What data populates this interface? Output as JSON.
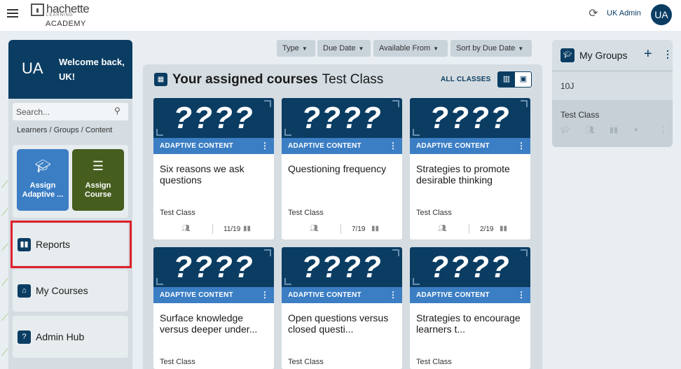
{
  "topbar": {
    "logo_brand": "hachette",
    "logo_sub": "LEARNING",
    "logo_academy": "ACADEMY",
    "user_name": "UK Admin",
    "user_initials": "UA"
  },
  "sidebar": {
    "welcome_initials": "UA",
    "welcome_line1": "Welcome back,",
    "welcome_line2": "UK!",
    "search_placeholder": "Search...",
    "search_hint": "Learners / Groups / Content",
    "tiles": [
      {
        "label": "Assign Adaptive ...",
        "icon": "graduation-cap-icon",
        "color": "#3b7ec4"
      },
      {
        "label": "Assign Course",
        "icon": "list-icon",
        "color": "#455e1e"
      }
    ],
    "nav": [
      {
        "label": "Reports",
        "icon": "bar-chart-icon"
      },
      {
        "label": "My Courses",
        "icon": "institution-icon"
      },
      {
        "label": "Admin Hub",
        "icon": "help-icon"
      }
    ]
  },
  "filters": [
    {
      "label": "Type"
    },
    {
      "label": "Due Date"
    },
    {
      "label": "Available From"
    },
    {
      "label": "Sort by Due Date"
    }
  ],
  "main": {
    "title": "Your assigned courses",
    "class_name": "Test Class",
    "all_classes": "ALL CLASSES",
    "cards": [
      {
        "hero": "????",
        "badge": "ADAPTIVE CONTENT",
        "title": "Six reasons we ask questions",
        "class": "Test Class",
        "count": "11/19"
      },
      {
        "hero": "????",
        "badge": "ADAPTIVE CONTENT",
        "title": "Questioning frequency",
        "class": "Test Class",
        "count": "7/19"
      },
      {
        "hero": "????",
        "badge": "ADAPTIVE CONTENT",
        "title": "Strategies to promote desirable thinking",
        "class": "Test Class",
        "count": "2/19"
      },
      {
        "hero": "????",
        "badge": "ADAPTIVE CONTENT",
        "title": "Surface knowledge versus deeper under...",
        "class": "Test Class",
        "count": ""
      },
      {
        "hero": "????",
        "badge": "ADAPTIVE CONTENT",
        "title": "Open questions versus closed questi...",
        "class": "Test Class",
        "count": ""
      },
      {
        "hero": "????",
        "badge": "ADAPTIVE CONTENT",
        "title": "Strategies to encourage learners t...",
        "class": "Test Class",
        "count": ""
      }
    ]
  },
  "groups": {
    "title": "My Groups",
    "items": [
      {
        "label": "10J"
      },
      {
        "label": "Test Class"
      }
    ]
  },
  "colors": {
    "navy": "#0b3d63",
    "blue": "#3b7ec4",
    "green": "#455e1e",
    "highlight": "#e0202a"
  }
}
